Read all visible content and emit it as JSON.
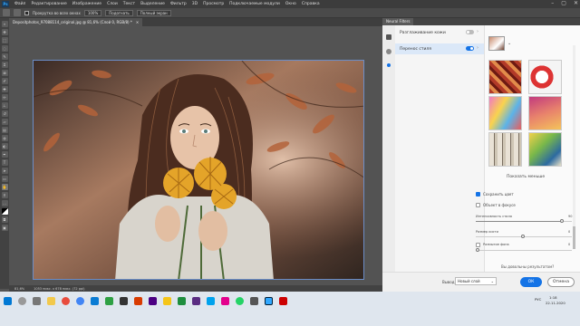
{
  "menubar": {
    "items": [
      "Файл",
      "Редактирование",
      "Изображение",
      "Слои",
      "Текст",
      "Выделение",
      "Фильтр",
      "3D",
      "Просмотр",
      "Подключаемые модули",
      "Окно",
      "Справка"
    ],
    "logo": "Ps"
  },
  "options": {
    "scroll_all_label": "Прокрутка во всех окнах",
    "zoom_value": "100%",
    "fit_label": "Подогнать",
    "fill_label": "Полный экран"
  },
  "document": {
    "tab_title": "Depositphotos_97088114_original.jpg @ 81,6% (Слой 0, RGB/8) *",
    "close": "×"
  },
  "status": {
    "zoom": "81,6%",
    "size": "1053 пикс. x 678 пикс. (72 ppi)"
  },
  "panel": {
    "tab": "Neural Filters",
    "filters": [
      {
        "label": "Разглаживание кожи",
        "enabled": false
      },
      {
        "label": "Перенос стиля",
        "enabled": true
      }
    ],
    "show_less": "Показать меньше",
    "preserve_color": "Сохранить цвет",
    "focus_subject": "Объект в фокусе",
    "style_strength_label": "Интенсивность стиля",
    "style_strength_value": "90",
    "brush_size_label": "Размер кисти",
    "brush_size_value": "0",
    "blur_bg_label": "Размытие фона",
    "blur_bg_value": "0",
    "feedback_question": "Вы довольны результатом?",
    "yes": "Да",
    "no": "Нет",
    "output_label": "Вывод",
    "output_value": "Новый слой",
    "ok": "ОК",
    "cancel": "Отмена",
    "accent": "#1473e6"
  },
  "taskbar": {
    "time": "1:18",
    "date": "22.11.2020",
    "lang": "РУС"
  }
}
